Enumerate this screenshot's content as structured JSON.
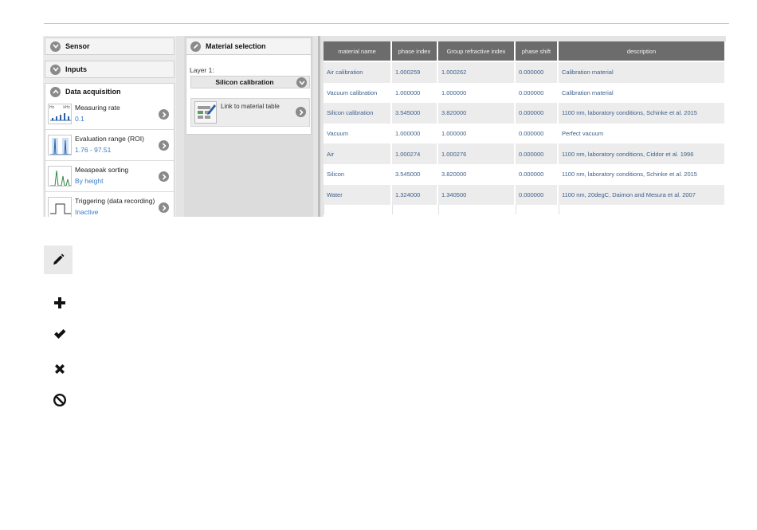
{
  "accordion": {
    "sensor_label": "Sensor",
    "inputs_label": "Inputs",
    "data_acq_label": "Data acquisition",
    "items": [
      {
        "title": "Measuring rate",
        "value": "0.1",
        "thumb_text_left": "Hz",
        "thumb_text_right": "kHz"
      },
      {
        "title": "Evaluation range (ROI)",
        "value": "1.76 - 97.51"
      },
      {
        "title": "Measpeak sorting",
        "value": "By height"
      },
      {
        "title": "Triggering (data recording)",
        "value": "Inactive"
      }
    ]
  },
  "material_panel": {
    "title": "Material selection",
    "layer_label": "Layer 1:",
    "selected_material": "Silicon calibration",
    "link_text": "Link to material table"
  },
  "table": {
    "headers": [
      "material name",
      "phase index",
      "Group refractive index",
      "phase shift",
      "description"
    ],
    "rows": [
      [
        "Air calibration",
        "1.000259",
        "1.000262",
        "0.000000",
        "Calibration material"
      ],
      [
        "Vacuum calibration",
        "1.000000",
        "1.000000",
        "0.000000",
        "Calibration material"
      ],
      [
        "Silicon calibration",
        "3.545000",
        "3.820000",
        "0.000000",
        "1100 nm, laboratory conditions, Schinke et al. 2015"
      ],
      [
        "Vacuum",
        "1.000000",
        "1.000000",
        "0.000000",
        "Perfect vacuum"
      ],
      [
        "Air",
        "1.000274",
        "1.000276",
        "0.000000",
        "1100 nm, laboratory conditions, Ciddor et al. 1996"
      ],
      [
        "Silicon",
        "3.545000",
        "3.820000",
        "0.000000",
        "1100 nm, laboratory conditions, Schinke et al. 2015"
      ],
      [
        "Water",
        "1.324000",
        "1.340500",
        "0.000000",
        "1100 nm, 20degC, Daimon and Mesura et al. 2007"
      ]
    ]
  },
  "legend_icons": [
    "pencil-icon",
    "plus-icon",
    "check-icon",
    "cross-icon",
    "no-entry-icon"
  ],
  "colors": {
    "header_bg": "#6c6c6c",
    "value_blue": "#3a7bc8",
    "cell_text": "#3d5f8a",
    "circle_gray": "#8a8a8a"
  }
}
